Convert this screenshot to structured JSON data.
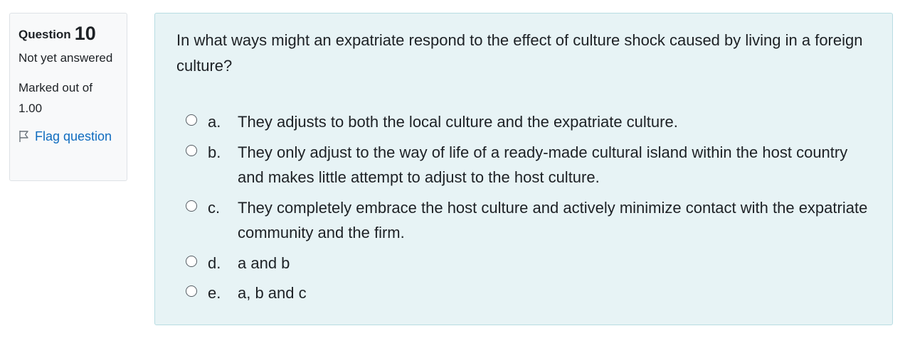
{
  "info": {
    "question_word": "Question",
    "question_number": "10",
    "state": "Not yet answered",
    "grade": "Marked out of 1.00",
    "flag_label": "Flag question",
    "flag_icon": "flag-icon",
    "link_color": "#0f6cbf"
  },
  "question": {
    "text": "In what ways might an expatriate respond to the effect of culture shock caused by living in a foreign culture?",
    "answers": [
      {
        "letter": "a.",
        "text": "They adjusts to both the local culture and the expatriate culture."
      },
      {
        "letter": "b.",
        "text": "They only adjust to the way of life of a ready-made cultural island within the host country and makes little attempt to adjust to the host culture."
      },
      {
        "letter": "c.",
        "text": "They completely embrace the host culture and actively minimize contact with the expatriate community and the firm."
      },
      {
        "letter": "d.",
        "text": "a and b"
      },
      {
        "letter": "e.",
        "text": "a, b and c"
      }
    ]
  },
  "colors": {
    "content_bg": "#e7f3f5",
    "content_border": "#b8dce2",
    "info_bg": "#f8f9fa"
  }
}
